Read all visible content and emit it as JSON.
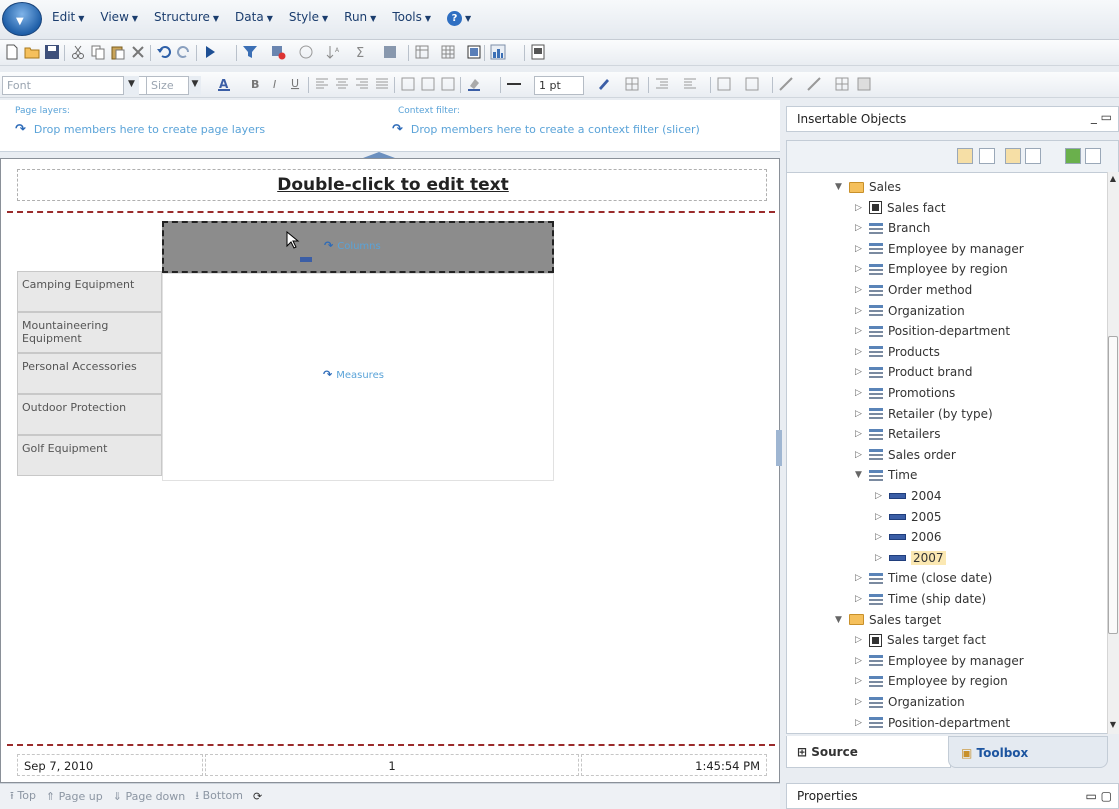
{
  "menu": {
    "items": [
      {
        "label": "Edit"
      },
      {
        "label": "View"
      },
      {
        "label": "Structure"
      },
      {
        "label": "Data"
      },
      {
        "label": "Style"
      },
      {
        "label": "Run"
      },
      {
        "label": "Tools"
      }
    ]
  },
  "format_toolbar": {
    "font_placeholder": "Font",
    "size_placeholder": "Size",
    "line_width": "1 pt"
  },
  "layers": {
    "page_layers_title": "Page layers:",
    "page_layers_text": "Drop members here to create page layers",
    "context_filter_title": "Context filter:",
    "context_filter_text": "Drop members here to create a context filter (slicer)"
  },
  "report": {
    "header_text": "Double-click to edit text",
    "columns_label": "Columns",
    "measures_label": "Measures",
    "rows": [
      "Camping Equipment",
      "Mountaineering Equipment",
      "Personal Accessories",
      "Outdoor Protection",
      "Golf Equipment"
    ],
    "footer_date": "Sep 7, 2010",
    "footer_page": "1",
    "footer_time": "1:45:54 PM"
  },
  "paging": {
    "top": "Top",
    "page_up": "Page up",
    "page_down": "Page down",
    "bottom": "Bottom"
  },
  "panel": {
    "title": "Insertable Objects",
    "tree": [
      {
        "label": "Sales",
        "icon": "folder-icon",
        "expanded": true,
        "level": 0
      },
      {
        "label": "Sales fact",
        "icon": "measure-folder-icon",
        "level": 1
      },
      {
        "label": "Branch",
        "icon": "dimension-icon",
        "level": 1
      },
      {
        "label": "Employee by manager",
        "icon": "dimension-icon",
        "level": 1
      },
      {
        "label": "Employee by region",
        "icon": "dimension-icon",
        "level": 1
      },
      {
        "label": "Order method",
        "icon": "dimension-icon",
        "level": 1
      },
      {
        "label": "Organization",
        "icon": "dimension-icon",
        "level": 1
      },
      {
        "label": "Position-department",
        "icon": "dimension-icon",
        "level": 1
      },
      {
        "label": "Products",
        "icon": "dimension-icon",
        "level": 1
      },
      {
        "label": "Product brand",
        "icon": "dimension-icon",
        "level": 1
      },
      {
        "label": "Promotions",
        "icon": "dimension-icon",
        "level": 1
      },
      {
        "label": "Retailer (by type)",
        "icon": "dimension-icon",
        "level": 1
      },
      {
        "label": "Retailers",
        "icon": "dimension-icon",
        "level": 1
      },
      {
        "label": "Sales order",
        "icon": "dimension-icon",
        "level": 1
      },
      {
        "label": "Time",
        "icon": "dimension-icon",
        "expanded": true,
        "level": 1
      },
      {
        "label": "2004",
        "icon": "member-icon",
        "level": 2
      },
      {
        "label": "2005",
        "icon": "member-icon",
        "level": 2
      },
      {
        "label": "2006",
        "icon": "member-icon",
        "level": 2
      },
      {
        "label": "2007",
        "icon": "member-icon",
        "level": 2,
        "selected": true
      },
      {
        "label": "Time (close date)",
        "icon": "dimension-icon",
        "level": 1
      },
      {
        "label": "Time (ship date)",
        "icon": "dimension-icon",
        "level": 1
      },
      {
        "label": "Sales target",
        "icon": "folder-icon",
        "expanded": true,
        "level": 0
      },
      {
        "label": "Sales target fact",
        "icon": "measure-folder-icon",
        "level": 1
      },
      {
        "label": "Employee by manager",
        "icon": "dimension-icon",
        "level": 1
      },
      {
        "label": "Employee by region",
        "icon": "dimension-icon",
        "level": 1
      },
      {
        "label": "Organization",
        "icon": "dimension-icon",
        "level": 1
      },
      {
        "label": "Position-department",
        "icon": "dimension-icon",
        "level": 1
      }
    ],
    "tabs": {
      "source": "Source",
      "toolbox": "Toolbox"
    },
    "properties": "Properties"
  },
  "colors": {
    "menu_text": "#1b3d6e",
    "drop_hint": "#5aa3d8",
    "page_rule": "#9a2b2b",
    "columns_zone": "#8c8c8c",
    "selected_item": "#fbe8b2"
  }
}
